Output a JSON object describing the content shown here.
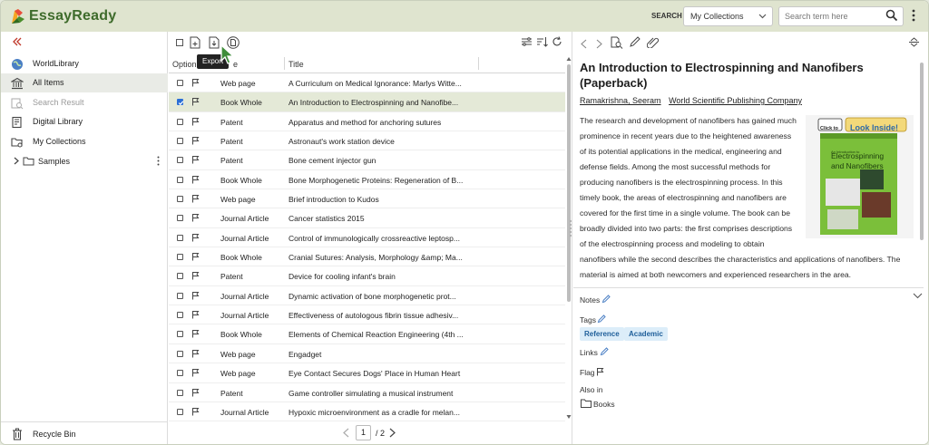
{
  "brand": {
    "name": "EssayReady"
  },
  "header": {
    "search_label": "SEARCH",
    "collection_select": "My Collections",
    "search_placeholder": "Search term here"
  },
  "sidebar": {
    "items": [
      {
        "label": "WorldLibrary",
        "icon": "globe-icon",
        "state": "normal"
      },
      {
        "label": "All Items",
        "icon": "library-icon",
        "state": "active"
      },
      {
        "label": "Search Result",
        "icon": "search-result-icon",
        "state": "disabled"
      },
      {
        "label": "Digital Library",
        "icon": "digital-library-icon",
        "state": "normal"
      },
      {
        "label": "My Collections",
        "icon": "collections-icon",
        "state": "normal"
      }
    ],
    "samples_label": "Samples",
    "recycle_label": "Recycle Bin"
  },
  "list": {
    "tooltip": "Export",
    "columns": {
      "options": "Option",
      "type": "e",
      "title": "Title"
    },
    "rows": [
      {
        "type": "Web page",
        "title": "A Curriculum on Medical Ignorance: Marlys Witte...",
        "checked": false
      },
      {
        "type": "Book Whole",
        "title": "An Introduction to Electrospinning and Nanofibe...",
        "checked": true
      },
      {
        "type": "Patent",
        "title": "Apparatus and method for anchoring sutures",
        "checked": false
      },
      {
        "type": "Patent",
        "title": "Astronaut's work station device",
        "checked": false
      },
      {
        "type": "Patent",
        "title": "Bone cement injector gun",
        "checked": false
      },
      {
        "type": "Book Whole",
        "title": "Bone Morphogenetic Proteins: Regeneration of B...",
        "checked": false
      },
      {
        "type": "Web page",
        "title": "Brief introduction to Kudos",
        "checked": false
      },
      {
        "type": "Journal Article",
        "title": "Cancer statistics 2015",
        "checked": false
      },
      {
        "type": "Journal Article",
        "title": "Control of immunologically crossreactive leptosp...",
        "checked": false
      },
      {
        "type": "Book Whole",
        "title": "Cranial Sutures: Analysis, Morphology &amp; Ma...",
        "checked": false
      },
      {
        "type": "Patent",
        "title": "Device for cooling infant's brain",
        "checked": false
      },
      {
        "type": "Journal Article",
        "title": "Dynamic activation of bone morphogenetic prot...",
        "checked": false
      },
      {
        "type": "Journal Article",
        "title": "Effectiveness of autologous fibrin tissue adhesiv...",
        "checked": false
      },
      {
        "type": "Book Whole",
        "title": "Elements of Chemical Reaction Engineering (4th ...",
        "checked": false
      },
      {
        "type": "Web page",
        "title": "Engadget",
        "checked": false
      },
      {
        "type": "Web page",
        "title": "Eye Contact Secures Dogs' Place in Human Heart",
        "checked": false
      },
      {
        "type": "Patent",
        "title": "Game controller simulating a musical instrument",
        "checked": false
      },
      {
        "type": "Journal Article",
        "title": "Hypoxic microenvironment as a cradle for melan...",
        "checked": false
      }
    ],
    "pager": {
      "current": "1",
      "total": "/ 2"
    }
  },
  "detail": {
    "title": "An Introduction to Electrospinning and Nanofibers (Paperback)",
    "authors": [
      "Ramakrishna, Seeram",
      "World Scientific Publishing Company"
    ],
    "abstract": "The research and development of nanofibers has gained much prominence in recent years due to the heightened awareness of its potential applications in the medical, engineering and defense fields. Among the most successful methods for producing nanofibers is the electrospinning process. In this timely book, the areas of electrospinning and nanofibers are covered for the first time in a single volume. The book can be broadly divided into two parts: the first comprises descriptions of the electrospinning process and modeling to obtain nanofibers while the second describes the characteristics and applications of nanofibers. The material is aimed at both newcomers and experienced researchers in the area.",
    "cover": {
      "badge_small": "Click to",
      "badge_big": "Look Inside!",
      "book_title_line1": "An Introduction to",
      "book_title_line2": "Electrospinning",
      "book_title_line3": "and Nanofibers"
    },
    "notes_label": "Notes",
    "tags_label": "Tags",
    "tags": [
      "Reference",
      "Academic"
    ],
    "links_label": "Links",
    "flag_label": "Flag",
    "also_in_label": "Also in",
    "also_in_folder": "Books"
  },
  "colors": {
    "header_bg": "#dfe4cf",
    "brand_green": "#3e6b2b",
    "selected_row": "#e4e9d7",
    "tag_bg": "#dcedf9",
    "tag_text": "#1f5f9a",
    "checkbox_blue": "#2b6ed6"
  }
}
